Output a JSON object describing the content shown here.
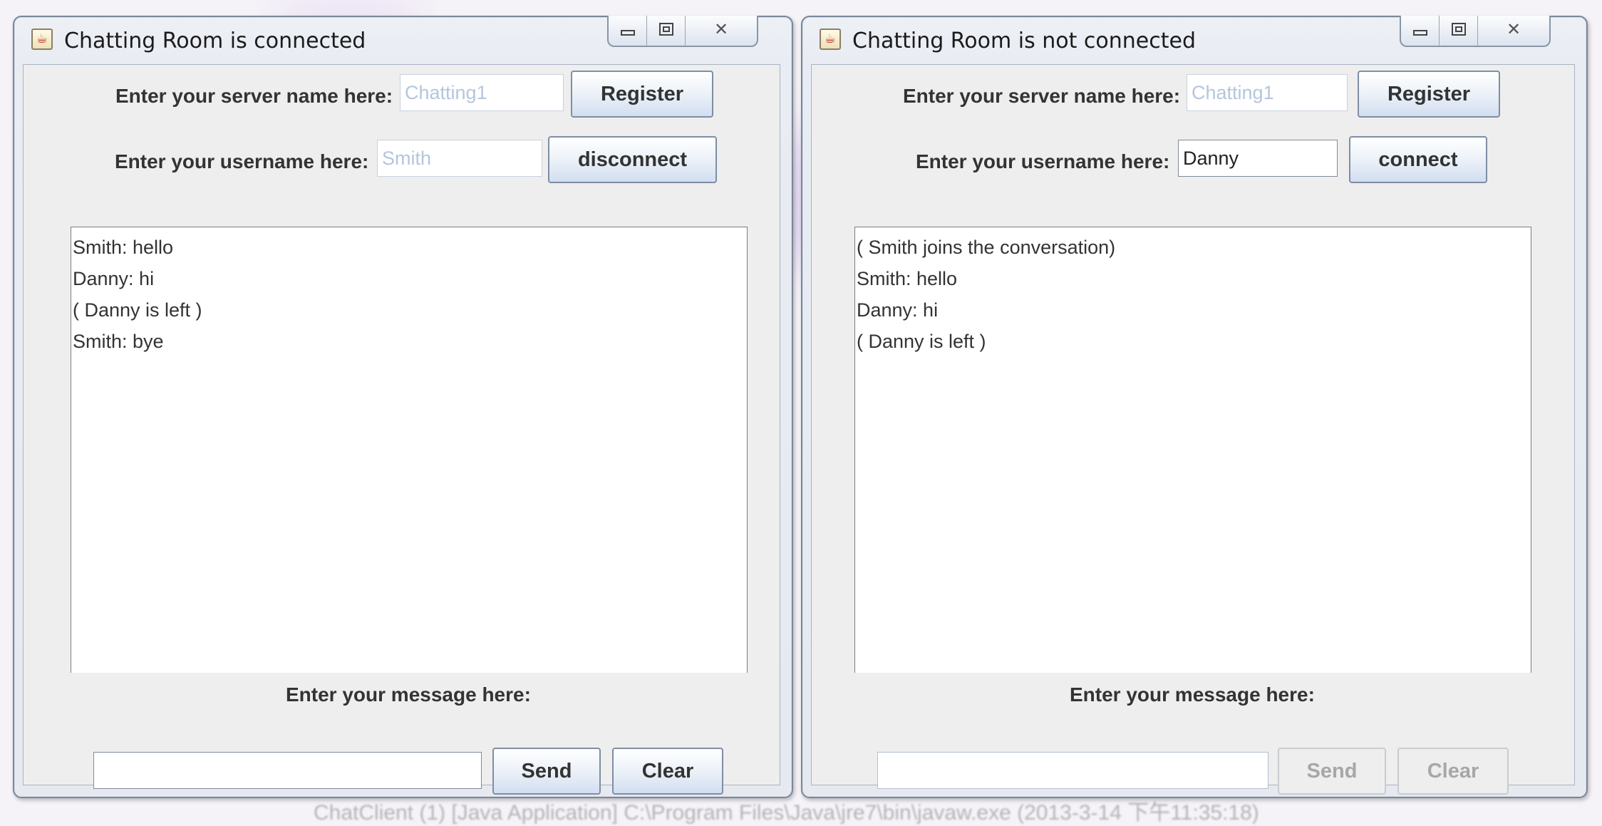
{
  "windows": [
    {
      "title": "Chatting Room is connected",
      "server_label": "Enter your server name here:",
      "server_value": "Chatting1",
      "register_label": "Register",
      "username_label": "Enter your username here:",
      "username_value": "Smith",
      "connect_label": "disconnect",
      "messages": [
        "Smith: hello",
        "Danny: hi",
        "( Danny is left )",
        "Smith: bye"
      ],
      "message_label": "Enter your message here:",
      "message_value": "",
      "send_label": "Send",
      "clear_label": "Clear"
    },
    {
      "title": "Chatting Room is not connected",
      "server_label": "Enter your server name here:",
      "server_value": "Chatting1",
      "register_label": "Register",
      "username_label": "Enter your username here:",
      "username_value": "Danny",
      "connect_label": "connect",
      "messages": [
        "( Smith joins the conversation)",
        "Smith: hello",
        "Danny: hi",
        "( Danny is left )"
      ],
      "message_label": "Enter your message here:",
      "message_value": "",
      "send_label": "Send",
      "clear_label": "Clear"
    }
  ],
  "background_status": "ChatClient (1) [Java Application] C:\\Program Files\\Java\\jre7\\bin\\javaw.exe (2013-3-14 下午11:35:18)",
  "icons": {
    "app": "java-cup-icon",
    "minimize": "minimize-icon",
    "maximize": "maximize-icon",
    "close": "close-icon"
  }
}
